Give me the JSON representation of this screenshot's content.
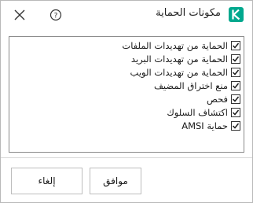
{
  "dialog": {
    "title": "مكونات الحماية",
    "help_glyph": "?"
  },
  "components": [
    {
      "label": "الحماية من تهديدات الملفات",
      "checked": true
    },
    {
      "label": "الحماية من تهديدات البريد",
      "checked": true
    },
    {
      "label": "الحماية من تهديدات الويب",
      "checked": true
    },
    {
      "label": "منع اختراق المضيف",
      "checked": true
    },
    {
      "label": "فحص",
      "checked": true
    },
    {
      "label": "اكتشاف السلوك",
      "checked": true
    },
    {
      "label": "حماية AMSI",
      "checked": true
    }
  ],
  "buttons": {
    "ok_label": "موافق",
    "cancel_label": "إلغاء"
  },
  "colors": {
    "brand": "#00a88e",
    "border": "#8a8a8a"
  },
  "icons": {
    "close": "close-icon",
    "help": "help-circle-icon",
    "logo": "kaspersky-logo",
    "check": "checkmark-icon"
  }
}
